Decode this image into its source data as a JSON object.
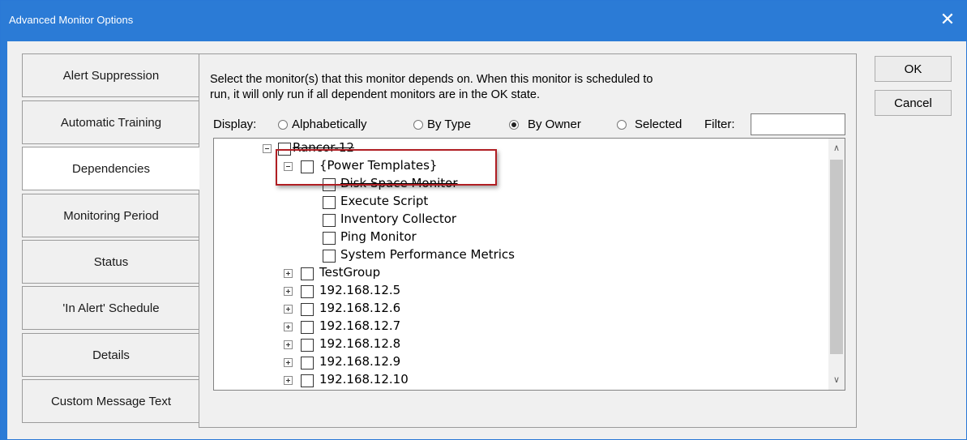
{
  "window": {
    "title": "Advanced Monitor Options",
    "close_glyph": "✕",
    "close_icon": "close-icon"
  },
  "tabs": [
    {
      "label": "Alert Suppression",
      "active": false
    },
    {
      "label": "Automatic Training",
      "active": false
    },
    {
      "label": "Dependencies",
      "active": true
    },
    {
      "label": "Monitoring Period",
      "active": false
    },
    {
      "label": "Status",
      "active": false
    },
    {
      "label": "'In Alert' Schedule",
      "active": false
    },
    {
      "label": "Details",
      "active": false
    },
    {
      "label": "Custom Message Text",
      "active": false
    }
  ],
  "dependencies": {
    "description_line1": "Select the monitor(s) that this monitor depends on.  When this monitor is scheduled to",
    "description_line2": "run, it will only run if all dependent monitors  are in the OK state.",
    "display_label": "Display:",
    "display_options": [
      {
        "label": "Alphabetically",
        "selected": false
      },
      {
        "label": "By Type",
        "selected": false
      },
      {
        "label": "By Owner",
        "selected": true
      },
      {
        "label": "Selected",
        "selected": false
      }
    ],
    "filter_label": "Filter:",
    "filter_value": "",
    "tree": [
      {
        "label": "Rancor-12",
        "level": 0,
        "expander": "minus",
        "checked": false
      },
      {
        "label": "{Power Templates}",
        "level": 1,
        "expander": "minus",
        "checked": false
      },
      {
        "label": "Disk Space Monitor",
        "level": 2,
        "expander": "none",
        "checked": false
      },
      {
        "label": "Execute Script",
        "level": 2,
        "expander": "none",
        "checked": false
      },
      {
        "label": "Inventory Collector",
        "level": 2,
        "expander": "none",
        "checked": false
      },
      {
        "label": "Ping Monitor",
        "level": 2,
        "expander": "none",
        "checked": false
      },
      {
        "label": "System Performance Metrics",
        "level": 2,
        "expander": "none",
        "checked": false
      },
      {
        "label": "TestGroup",
        "level": 1,
        "expander": "plus",
        "checked": false
      },
      {
        "label": "192.168.12.5",
        "level": 1,
        "expander": "plus",
        "checked": false
      },
      {
        "label": "192.168.12.6",
        "level": 1,
        "expander": "plus",
        "checked": false
      },
      {
        "label": "192.168.12.7",
        "level": 1,
        "expander": "plus",
        "checked": false
      },
      {
        "label": "192.168.12.8",
        "level": 1,
        "expander": "plus",
        "checked": false
      },
      {
        "label": "192.168.12.9",
        "level": 1,
        "expander": "plus",
        "checked": false
      },
      {
        "label": "192.168.12.10",
        "level": 1,
        "expander": "plus",
        "checked": false
      }
    ],
    "scroll_up_glyph": "∧",
    "scroll_down_glyph": "∨"
  },
  "buttons": {
    "ok_label": "OK",
    "cancel_label": "Cancel"
  },
  "colors": {
    "titlebar": "#2b7bd6",
    "highlight_border": "#b01e23"
  }
}
